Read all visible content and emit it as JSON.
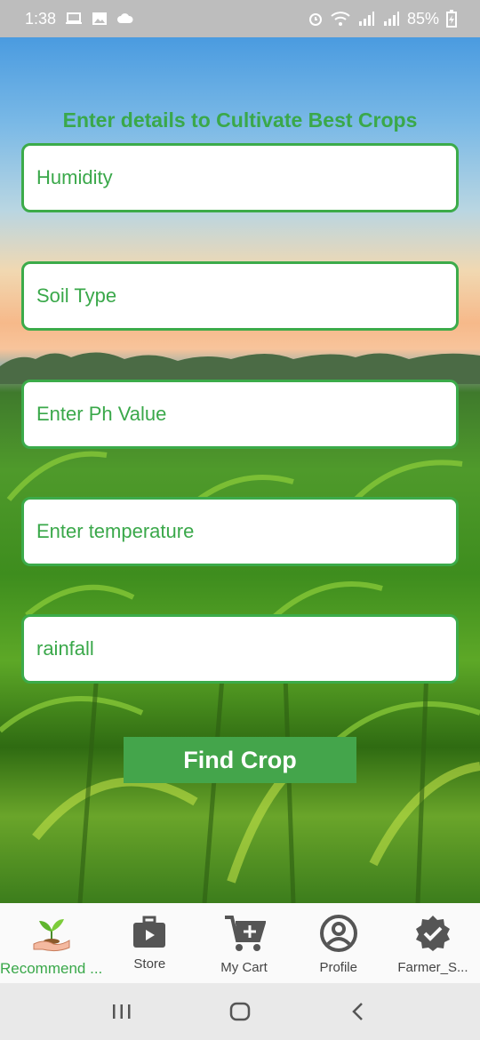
{
  "status_bar": {
    "time": "1:38",
    "battery": "85%",
    "left_icons": [
      "laptop-icon",
      "image-icon",
      "cloud-icon"
    ],
    "right_icons": [
      "alarm-icon",
      "wifi-icon",
      "signal-icon",
      "signal-icon",
      "battery-charging-icon"
    ]
  },
  "page": {
    "title": "Enter details to Cultivate Best Crops"
  },
  "form": {
    "fields": [
      {
        "placeholder": "Humidity",
        "value": ""
      },
      {
        "placeholder": "Soil Type",
        "value": ""
      },
      {
        "placeholder": "Enter Ph Value",
        "value": ""
      },
      {
        "placeholder": "Enter temperature",
        "value": ""
      },
      {
        "placeholder": "rainfall",
        "value": ""
      }
    ],
    "submit_label": "Find Crop"
  },
  "bottom_nav": {
    "items": [
      {
        "label": "Recommend ...",
        "icon": "plant-hand-icon",
        "active": true
      },
      {
        "label": "Store",
        "icon": "store-bag-icon",
        "active": false
      },
      {
        "label": "My Cart",
        "icon": "cart-add-icon",
        "active": false
      },
      {
        "label": "Profile",
        "icon": "profile-icon",
        "active": false
      },
      {
        "label": "Farmer_S...",
        "icon": "verified-badge-icon",
        "active": false
      }
    ]
  },
  "system_nav": {
    "buttons": [
      "recents-icon",
      "home-icon",
      "back-icon"
    ]
  },
  "colors": {
    "accent_green": "#3aa84a",
    "button_green": "#44a54b",
    "status_bar_bg": "#bdbdbd"
  }
}
